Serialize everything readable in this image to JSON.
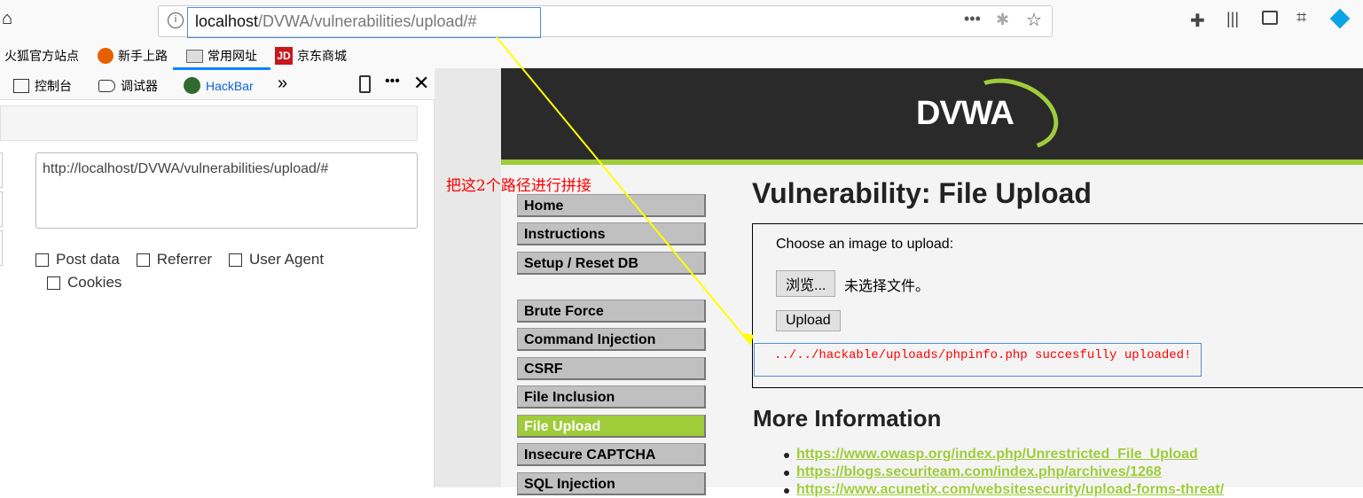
{
  "browser": {
    "url_host": "localhost",
    "url_path": "/DVWA/vulnerabilities/upload/#"
  },
  "bookmarks": [
    "火狐官方站点",
    "新手上路",
    "常用网址",
    "京东商城"
  ],
  "devtools": {
    "tabs": [
      "控制台",
      "调试器",
      "HackBar"
    ],
    "active_tab": "HackBar"
  },
  "hackbar": {
    "url_value": "http://localhost/DVWA/vulnerabilities/upload/#",
    "options": [
      "Post data",
      "Referrer",
      "User Agent",
      "Cookies"
    ]
  },
  "annotation": {
    "text": "把这2个路径进行拼接",
    "color": "#ff0000",
    "line_color": "#ffff00"
  },
  "dvwa": {
    "logo": "DVWA",
    "menu": [
      "Home",
      "Instructions",
      "Setup / Reset DB",
      "Brute Force",
      "Command Injection",
      "CSRF",
      "File Inclusion",
      "File Upload",
      "Insecure CAPTCHA",
      "SQL Injection"
    ],
    "active_menu": "File Upload",
    "title": "Vulnerability: File Upload",
    "choose_label": "Choose an image to upload:",
    "browse_button": "浏览...",
    "no_file": "未选择文件。",
    "upload_button": "Upload",
    "message": "../../hackable/uploads/phpinfo.php succesfully uploaded!",
    "more_info_title": "More Information",
    "links": [
      "https://www.owasp.org/index.php/Unrestricted_File_Upload",
      "https://blogs.securiteam.com/index.php/archives/1268",
      "https://www.acunetix.com/websitesecurity/upload-forms-threat/"
    ],
    "accent": "#9fcc3b"
  }
}
